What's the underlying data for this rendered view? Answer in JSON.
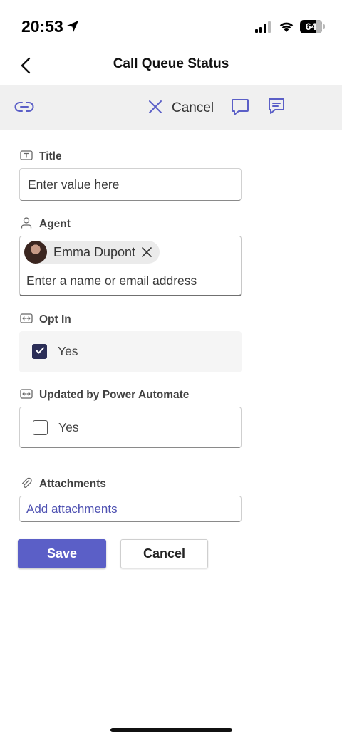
{
  "status_bar": {
    "time": "20:53",
    "battery_level": "64",
    "icons": [
      "location-arrow-icon",
      "cellular-signal-icon",
      "wifi-icon",
      "battery-icon"
    ]
  },
  "header": {
    "title": "Call Queue Status",
    "back_icon": "chevron-left-icon"
  },
  "toolbar": {
    "cancel_label": "Cancel",
    "icons": [
      "link-icon",
      "close-icon",
      "chat-icon",
      "notes-icon"
    ]
  },
  "form": {
    "title_field": {
      "label": "Title",
      "placeholder": "Enter value here",
      "icon": "text-field-icon"
    },
    "agent_field": {
      "label": "Agent",
      "selected_person": "Emma Dupont",
      "placeholder": "Enter a name or email address",
      "icon": "person-icon"
    },
    "opt_in_field": {
      "label": "Opt In",
      "option_label": "Yes",
      "checked": true,
      "icon": "boolean-toggle-icon"
    },
    "updated_field": {
      "label": "Updated by Power Automate",
      "option_label": "Yes",
      "checked": false,
      "icon": "boolean-toggle-icon"
    },
    "attachments_field": {
      "label": "Attachments",
      "link_text": "Add attachments",
      "icon": "paperclip-icon"
    }
  },
  "actions": {
    "save_label": "Save",
    "cancel_label": "Cancel"
  },
  "colors": {
    "accent": "#5b5fc7",
    "link": "#4f52b2",
    "toolbar_bg": "#f0f0f0",
    "checkbox_checked": "#2b2e57"
  }
}
